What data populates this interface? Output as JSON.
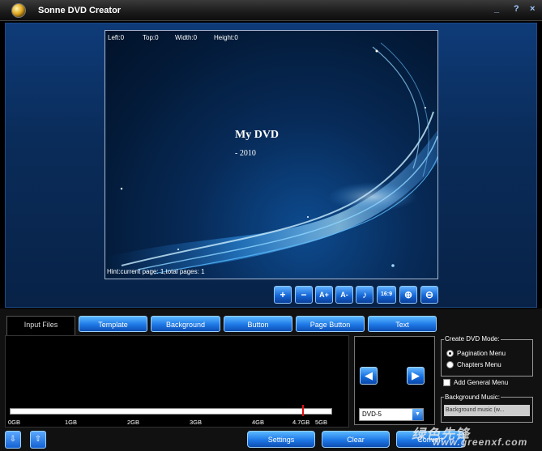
{
  "window": {
    "title": "Sonne DVD Creator",
    "controls": [
      "_",
      "?",
      "×"
    ]
  },
  "preview": {
    "coords": {
      "left": "Left:0",
      "top": "Top:0",
      "width": "Width:0",
      "height": "Height:0"
    },
    "dvd_title": "My DVD",
    "dvd_subtitle": "- 2010",
    "hint": "Hint:current page: 1,total pages: 1"
  },
  "toolbar": [
    {
      "name": "add-icon",
      "glyph": "+"
    },
    {
      "name": "remove-icon",
      "glyph": "−"
    },
    {
      "name": "font-increase-icon",
      "glyph": "A+"
    },
    {
      "name": "font-decrease-icon",
      "glyph": "A-"
    },
    {
      "name": "music-note-icon",
      "glyph": "♪"
    },
    {
      "name": "aspect-ratio-button",
      "glyph": "16:9"
    },
    {
      "name": "zoom-in-icon",
      "glyph": "⊕"
    },
    {
      "name": "zoom-out-icon",
      "glyph": "⊖"
    }
  ],
  "tabs": [
    "Input Files",
    "Template",
    "Background",
    "Button",
    "Page Button",
    "Text"
  ],
  "capacity_scale": {
    "ticks": [
      "0GB",
      "1GB",
      "2GB",
      "3GB",
      "4GB",
      "4.7GB",
      "5GB"
    ],
    "marker_color": "#e01010"
  },
  "disc": {
    "selected": "DVD-5"
  },
  "dvd_mode": {
    "title": "Create DVD Mode:",
    "options": [
      "Pagination Menu",
      "Chapters Menu"
    ],
    "selected": "Pagination Menu"
  },
  "general_menu": {
    "label": "Add General Menu",
    "checked": false
  },
  "background_music": {
    "title": "Background Music:",
    "value": "Background music (w..."
  },
  "actions": {
    "settings": "Settings",
    "clear": "Clear",
    "convert": "Convert"
  },
  "watermark": {
    "text": "绿色先锋",
    "url": "www.greenxf.com"
  },
  "colors": {
    "accent": "#1e78e6",
    "background": "#0a2c5a"
  }
}
